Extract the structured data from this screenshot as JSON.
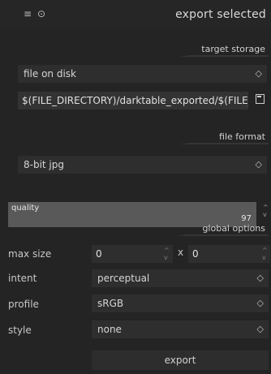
{
  "header": {
    "menu_icon": "hamburger-menu-icon",
    "reset_icon": "reset-icon",
    "title": "export selected"
  },
  "target_storage": {
    "section_label": "target storage",
    "storage_type": "file on disk",
    "filename_template": "$(FILE_DIRECTORY)/darktable_exported/$(FILE_",
    "folder_icon": "folder-icon"
  },
  "file_format": {
    "section_label": "file format",
    "format": "8-bit jpg",
    "quality_label": "quality",
    "quality_value": "97"
  },
  "global_options": {
    "section_label": "global options",
    "max_size_label": "max size",
    "max_width": "0",
    "times": "x",
    "max_height": "0",
    "intent_label": "intent",
    "intent_value": "perceptual",
    "profile_label": "profile",
    "profile_value": "sRGB",
    "style_label": "style",
    "style_value": "none"
  },
  "export_button": "export",
  "glyphs": {
    "combo_arrows": "◇",
    "spin_up": "^",
    "spin_down": "v"
  }
}
